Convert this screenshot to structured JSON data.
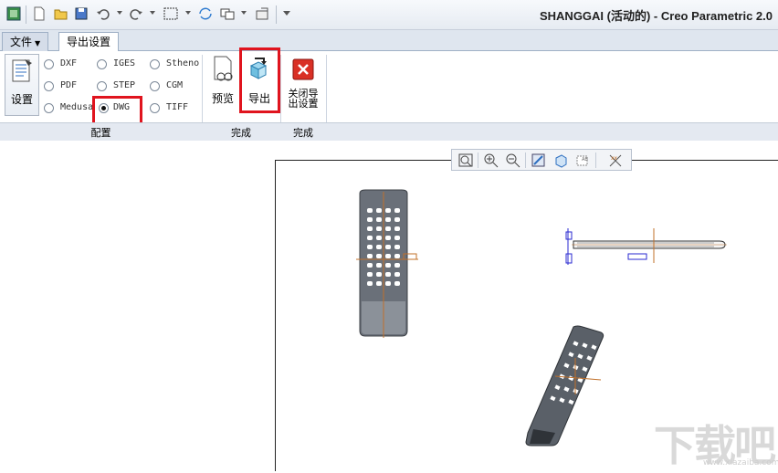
{
  "window": {
    "title": "SHANGGAI (活动的) - Creo Parametric 2.0"
  },
  "tabs": [
    {
      "label": "文件"
    },
    {
      "label": "导出设置"
    }
  ],
  "ribbon": {
    "settings_button": "设置",
    "formats": [
      {
        "label": "DXF",
        "selected": false
      },
      {
        "label": "IGES",
        "selected": false
      },
      {
        "label": "Stheno",
        "selected": false
      },
      {
        "label": "PDF",
        "selected": false
      },
      {
        "label": "STEP",
        "selected": false
      },
      {
        "label": "CGM",
        "selected": false
      },
      {
        "label": "Medusa",
        "selected": false
      },
      {
        "label": "DWG",
        "selected": true
      },
      {
        "label": "TIFF",
        "selected": false
      }
    ],
    "preview_button": "预览",
    "export_button": "导出",
    "close_button": "关闭导出设置",
    "groups": {
      "config": "配置",
      "finish1": "完成",
      "finish2": "完成"
    }
  },
  "watermark": {
    "text": "下载吧",
    "url": "www.xiazaiba.com"
  },
  "colors": {
    "highlight": "#e0141e",
    "part": "#5a6068",
    "datum": "#c0702a"
  }
}
